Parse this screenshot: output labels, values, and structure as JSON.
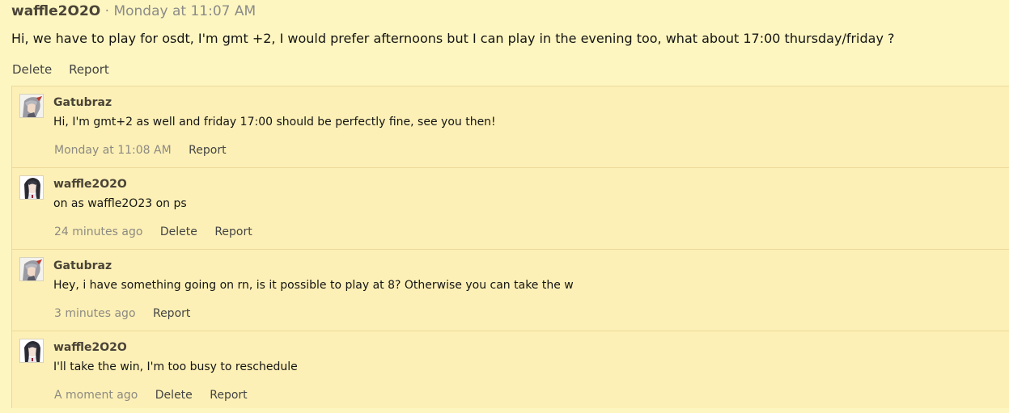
{
  "post": {
    "author": "waffle2O2O",
    "separator": "·",
    "time": "Monday at 11:07 AM",
    "body": "Hi, we have to play for osdt, I'm gmt +2, I would prefer afternoons but I can play in the evening too, what about 17:00 thursday/friday ?",
    "actions": {
      "delete": "Delete",
      "report": "Report"
    }
  },
  "comments": [
    {
      "author": "Gatubraz",
      "avatar": "grey-hair-anime-avatar",
      "text": "Hi, I'm gmt+2 as well and friday 17:00 should be perfectly fine, see you then!",
      "time": "Monday at 11:08 AM",
      "report": "Report"
    },
    {
      "author": "waffle2O2O",
      "avatar": "dark-hair-anime-avatar",
      "text": "on as waffle2O23 on ps",
      "time": "24 minutes ago",
      "delete": "Delete",
      "report": "Report"
    },
    {
      "author": "Gatubraz",
      "avatar": "grey-hair-anime-avatar",
      "text": "Hey, i have something going on rn, is it possible to play at 8? Otherwise you can take the w",
      "time": "3 minutes ago",
      "report": "Report"
    },
    {
      "author": "waffle2O2O",
      "avatar": "dark-hair-anime-avatar",
      "text": "I'll take the win, I'm too busy to reschedule",
      "time": "A moment ago",
      "delete": "Delete",
      "report": "Report"
    }
  ]
}
